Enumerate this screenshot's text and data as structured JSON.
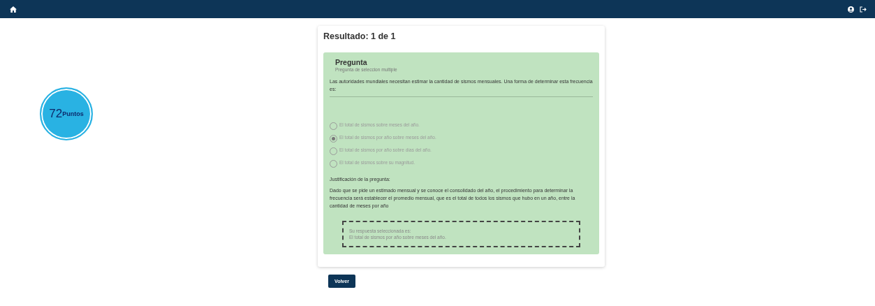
{
  "score": {
    "value": "72",
    "unit": "Puntos"
  },
  "result_title": "Resultado: 1 de 1",
  "question": {
    "title": "Pregunta",
    "subtitle": "Pregunta de seleccion multiple",
    "text": "Las autoridades mundiales necesitan estimar la cantidad de sismos mensuales. Una forma de determinar esta frecuencia es:",
    "options": [
      {
        "label": "El total de sismos sobre meses del año.",
        "selected": false
      },
      {
        "label": "El total de sismos por año sobre meses del año.",
        "selected": true
      },
      {
        "label": "El total de sismos por año sobre días del año.",
        "selected": false
      },
      {
        "label": "El total de sismos sobre su magnitud.",
        "selected": false
      }
    ],
    "justification_title": "Justificación de la pregunta:",
    "justification": "Dado que se pide un estimado mensual y se conoce el consolidado del año, el procedimiento para determinar la frecuencia será establecer el promedio mensual, que es el total de todos los sismos que hubo en un año, entre la cantidad de meses por año",
    "answer_label": "Su respuesta seleccionada es:",
    "answer": "El total de sismos por año sobre meses del año."
  },
  "back_button": "Volver"
}
